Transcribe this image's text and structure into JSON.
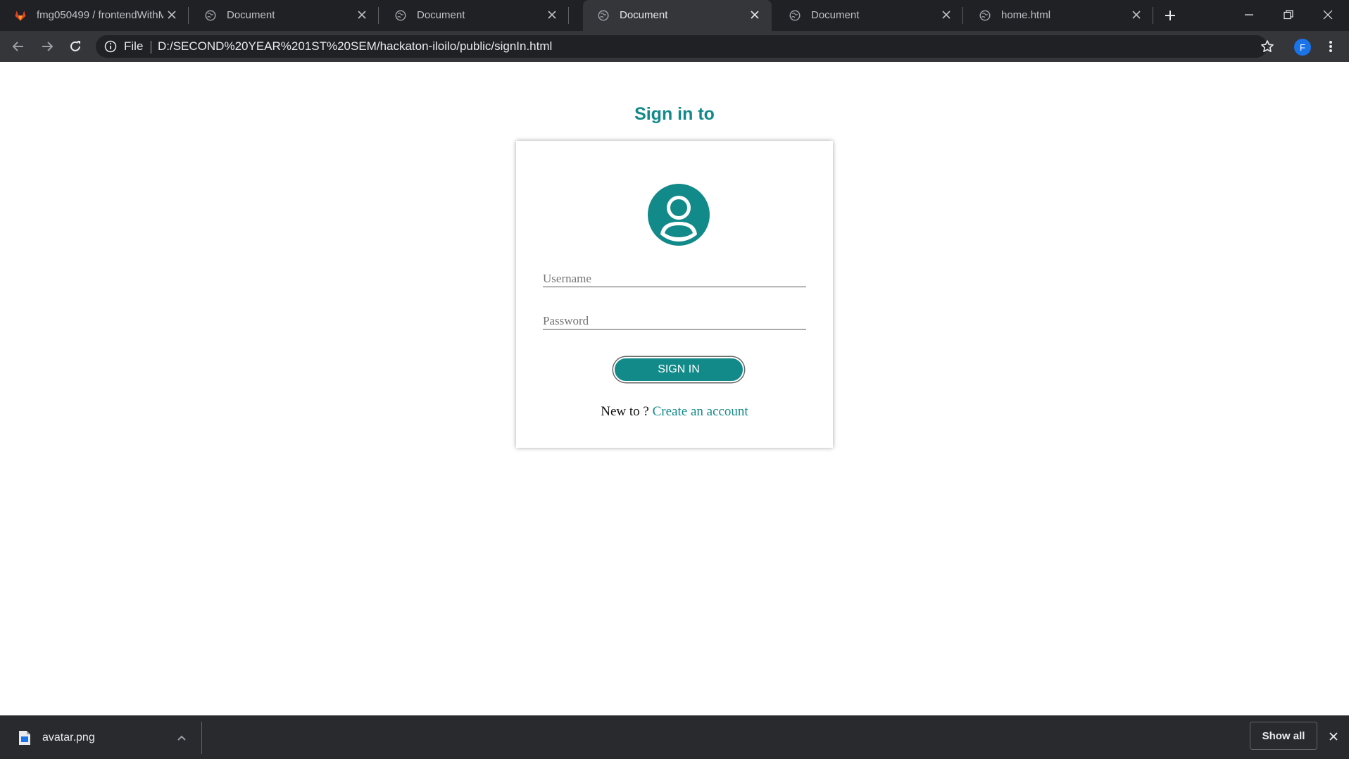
{
  "browser": {
    "tabs": [
      {
        "title": "fmg050499 / frontendWithM",
        "favicon": "gitlab-icon",
        "active": false
      },
      {
        "title": "Document",
        "favicon": "globe-icon",
        "active": false
      },
      {
        "title": "Document",
        "favicon": "globe-icon",
        "active": false
      },
      {
        "title": "Document",
        "favicon": "globe-icon",
        "active": true
      },
      {
        "title": "Document",
        "favicon": "globe-icon",
        "active": false
      },
      {
        "title": "home.html",
        "favicon": "globe-icon",
        "active": false
      }
    ],
    "address": {
      "scheme": "File",
      "url": "D:/SECOND%20YEAR%201ST%20SEM/hackaton-iloilo/public/signIn.html"
    },
    "profile_initial": "F"
  },
  "page": {
    "heading": "Sign in to",
    "username_placeholder": "Username",
    "password_placeholder": "Password",
    "signin_label": "SIGN IN",
    "new_to_text": "New to ?",
    "create_account_label": "Create an account"
  },
  "downloads": {
    "file_name": "avatar.png",
    "show_all_label": "Show all"
  },
  "colors": {
    "accent": "#138a8a",
    "chrome_dark": "#202124",
    "chrome_toolbar": "#35363a"
  }
}
